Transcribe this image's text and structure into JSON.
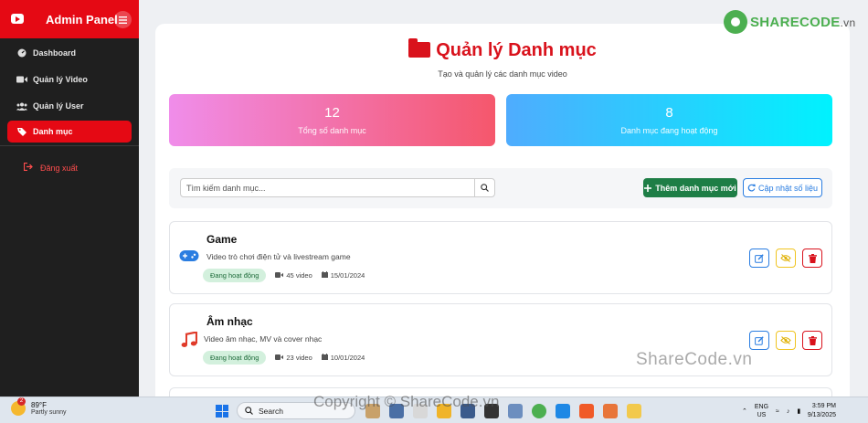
{
  "sidebar": {
    "title": "Admin Panel",
    "items": [
      {
        "label": "Dashboard"
      },
      {
        "label": "Quản lý Video"
      },
      {
        "label": "Quản lý User"
      },
      {
        "label": "Danh mục"
      }
    ],
    "logout": "Đăng xuất"
  },
  "page": {
    "title": "Quản lý Danh mục",
    "subtitle": "Tạo và quản lý các danh mục video"
  },
  "stats": [
    {
      "value": "12",
      "label": "Tổng số danh mục"
    },
    {
      "value": "8",
      "label": "Danh mục đang hoạt động"
    }
  ],
  "toolbar": {
    "search_placeholder": "Tìm kiếm danh mục...",
    "add_label": "Thêm danh mục mới",
    "refresh_label": "Cập nhật số liệu"
  },
  "categories": [
    {
      "name": "Game",
      "desc": "Video trò chơi điện tử và livestream game",
      "status": "Đang hoạt động",
      "videos": "45 video",
      "date": "15/01/2024",
      "icon": "gamepad-icon"
    },
    {
      "name": "Âm nhạc",
      "desc": "Video âm nhạc, MV và cover nhạc",
      "status": "Đang hoạt động",
      "videos": "23 video",
      "date": "10/01/2024",
      "icon": "music-icon"
    }
  ],
  "watermarks": {
    "logo_main": "SHARECODE",
    "logo_suffix": ".vn",
    "mid": "ShareCode.vn",
    "bottom": "Copyright © ShareCode.vn"
  },
  "taskbar": {
    "weather_badge": "2",
    "temp": "89°F",
    "condition": "Partly sunny",
    "search": "Search",
    "lang1": "ENG",
    "lang2": "US",
    "time": "3:59 PM",
    "date": "9/13/2025"
  },
  "colors": {
    "brand": "#e50914",
    "title": "#d9121c",
    "add": "#1e7e46",
    "refresh": "#2a7de1"
  }
}
